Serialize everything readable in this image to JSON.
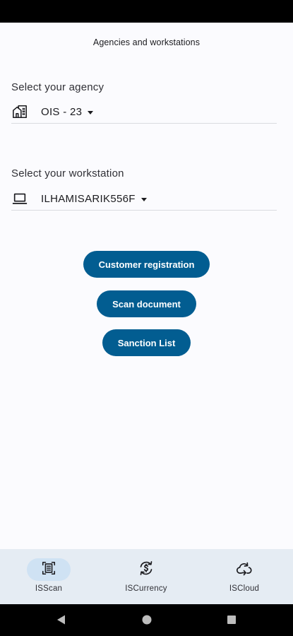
{
  "app_bar": {
    "title": "Agencies and workstations"
  },
  "agency": {
    "label": "Select your agency",
    "value": "OIS - 23",
    "icon": "office-building-icon"
  },
  "workstation": {
    "label": "Select your workstation",
    "value": "ILHAMISARIK556F",
    "icon": "laptop-icon"
  },
  "actions": {
    "customer_registration": "Customer registration",
    "scan_document": "Scan document",
    "sanction_list": "Sanction List"
  },
  "bottom_nav": {
    "items": [
      {
        "label": "ISScan",
        "icon": "document-scan-icon",
        "active": true
      },
      {
        "label": "ISCurrency",
        "icon": "currency-exchange-icon",
        "active": false
      },
      {
        "label": "ISCloud",
        "icon": "cloud-sync-icon",
        "active": false
      }
    ]
  },
  "colors": {
    "primary": "#025d91",
    "nav_background": "#e5ecf3",
    "nav_active_indicator": "#cfe2f3",
    "background": "#fbfbfe"
  }
}
